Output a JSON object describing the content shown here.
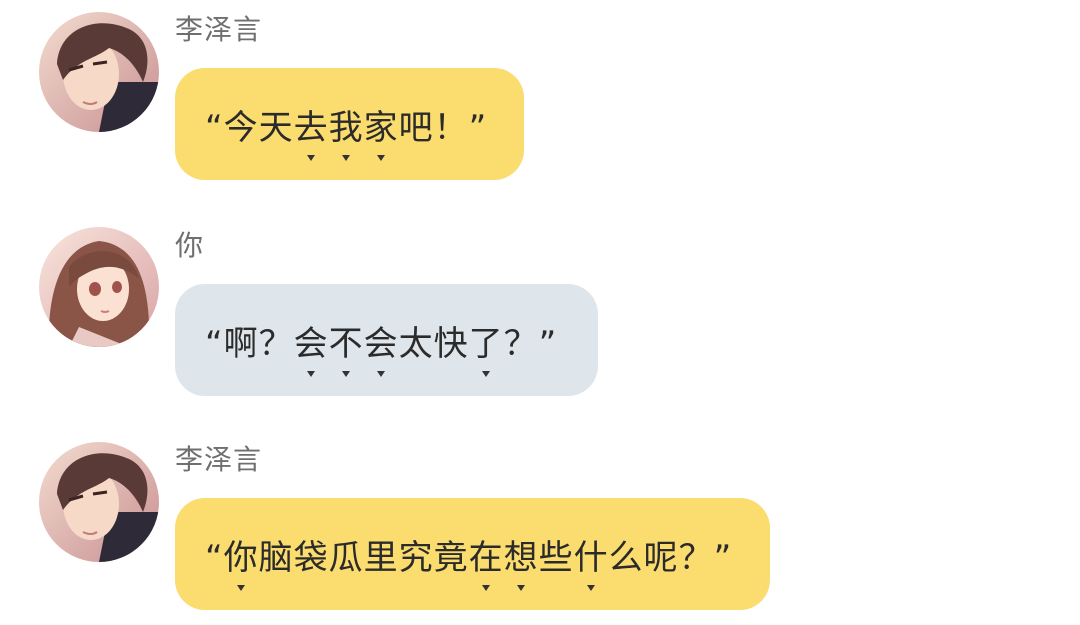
{
  "colors": {
    "self_bubble": "#fbdc6e",
    "other_bubble": "#dfe6eb",
    "sender_text": "#6f6f6f",
    "message_text": "#2b2b2b"
  },
  "messages": [
    {
      "sender": "李泽言",
      "avatar": "male-avatar",
      "bubble_color": "yellow",
      "text_parts": [
        "“今天",
        "去",
        "我",
        "家",
        "吧！”"
      ]
    },
    {
      "sender": "你",
      "avatar": "female-avatar",
      "bubble_color": "gray",
      "text_parts": [
        "“啊？",
        "会",
        "不",
        "会",
        "太",
        "快",
        "了",
        "？”"
      ]
    },
    {
      "sender": "李泽言",
      "avatar": "male-avatar",
      "bubble_color": "yellow",
      "text_parts": [
        "“",
        "你",
        "脑袋瓜里究竟",
        "在",
        "想",
        "些",
        "什",
        "么呢？”"
      ]
    }
  ]
}
